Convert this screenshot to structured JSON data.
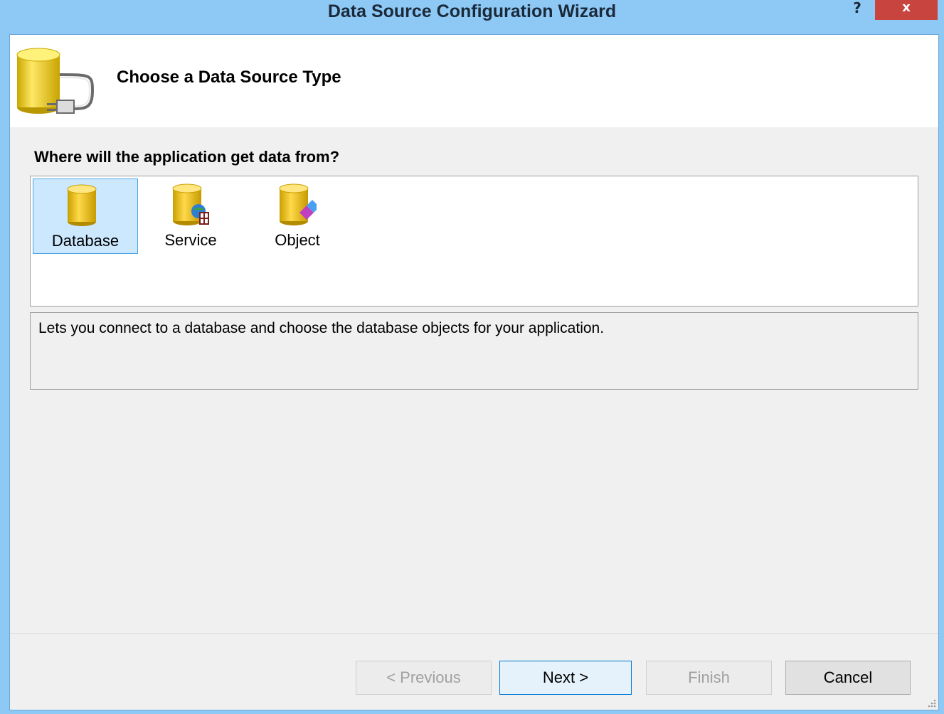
{
  "window": {
    "title": "Data Source Configuration Wizard",
    "help_label": "?",
    "close_label": "x"
  },
  "header": {
    "title": "Choose a Data Source Type",
    "icon": "database-plug-icon"
  },
  "question": "Where will the application get data from?",
  "list": {
    "items": [
      {
        "label": "Database",
        "icon": "database-icon",
        "selected": true
      },
      {
        "label": "Service",
        "icon": "service-database-icon",
        "selected": false
      },
      {
        "label": "Object",
        "icon": "object-database-icon",
        "selected": false
      }
    ]
  },
  "description": "Lets you connect to a database and choose the database objects for your application.",
  "buttons": {
    "previous": "< Previous",
    "next": "Next >",
    "finish": "Finish",
    "cancel": "Cancel"
  },
  "colors": {
    "title_bar": "#8ec8f5",
    "close_button": "#c7453e",
    "selection": "#cce8ff",
    "selection_border": "#4aa3e6"
  }
}
